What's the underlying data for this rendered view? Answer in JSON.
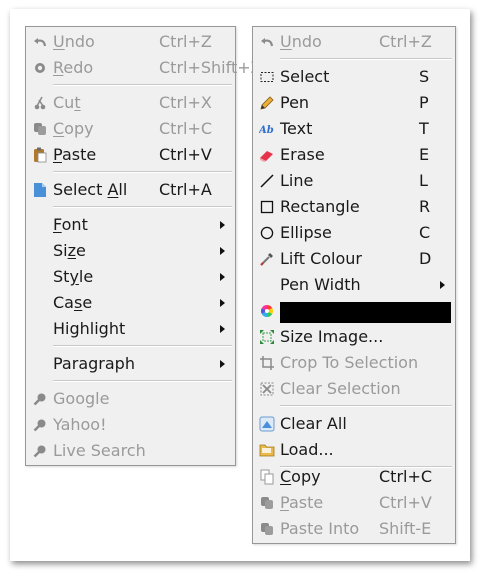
{
  "left_menu": {
    "items": [
      {
        "label": "Undo",
        "u": "U",
        "rest": "ndo",
        "shortcut": "Ctrl+Z",
        "icon": "undo-icon"
      },
      {
        "label": "Redo",
        "u": "R",
        "rest": "edo",
        "shortcut": "Ctrl+Shift+Z",
        "icon": "redo-icon"
      },
      {
        "label": "Cut",
        "pre": "Cu",
        "u": "t",
        "shortcut": "Ctrl+X",
        "icon": "cut-icon"
      },
      {
        "label": "Copy",
        "u": "C",
        "rest": "opy",
        "shortcut": "Ctrl+C",
        "icon": "copy-icon"
      },
      {
        "label": "Paste",
        "u": "P",
        "rest": "aste",
        "shortcut": "Ctrl+V",
        "icon": "paste-icon"
      },
      {
        "label": "Select All",
        "pre": "Select ",
        "u": "A",
        "rest": "ll",
        "shortcut": "Ctrl+A",
        "icon": "select-all-icon"
      },
      {
        "label": "Font",
        "u": "F",
        "rest": "ont"
      },
      {
        "label": "Size",
        "pre": "Si",
        "u": "z",
        "rest": "e"
      },
      {
        "label": "Style",
        "pre": "St",
        "u": "y",
        "rest": "le"
      },
      {
        "label": "Case",
        "pre": "Ca",
        "u": "s",
        "rest": "e"
      },
      {
        "label": "Highlight"
      },
      {
        "label": "Paragraph"
      },
      {
        "label": "Google",
        "icon": "search-icon"
      },
      {
        "label": "Yahoo!",
        "icon": "search-icon"
      },
      {
        "label": "Live Search",
        "icon": "search-icon"
      }
    ]
  },
  "right_menu": {
    "items": [
      {
        "label": "Undo",
        "u": "U",
        "rest": "ndo",
        "shortcut": "Ctrl+Z",
        "icon": "undo-icon"
      },
      {
        "label": "Select",
        "key": "S",
        "icon": "select-rect-icon"
      },
      {
        "label": "Pen",
        "key": "P",
        "icon": "pen-icon"
      },
      {
        "label": "Text",
        "key": "T",
        "icon": "text-icon"
      },
      {
        "label": "Erase",
        "key": "E",
        "icon": "eraser-icon"
      },
      {
        "label": "Line",
        "key": "L",
        "icon": "line-icon"
      },
      {
        "label": "Rectangle",
        "key": "R",
        "icon": "rectangle-icon"
      },
      {
        "label": "Ellipse",
        "key": "C",
        "icon": "ellipse-icon"
      },
      {
        "label": "Lift Colour",
        "key": "D",
        "icon": "eyedropper-icon"
      },
      {
        "label": "Pen Width"
      },
      {
        "label": "",
        "icon": "color-wheel-icon",
        "swatch": "#000000"
      },
      {
        "label": "Size Image...",
        "icon": "resize-icon"
      },
      {
        "label": "Crop To Selection",
        "icon": "crop-icon"
      },
      {
        "label": "Clear Selection",
        "icon": "clear-selection-icon"
      },
      {
        "label": "Clear All",
        "icon": "clear-all-icon"
      },
      {
        "label": "Load...",
        "icon": "folder-icon"
      },
      {
        "label": "Copy",
        "u": "C",
        "rest": "opy",
        "shortcut": "Ctrl+C",
        "icon": "copy-icon"
      },
      {
        "label": "Paste",
        "u": "P",
        "rest": "aste",
        "shortcut": "Ctrl+V",
        "icon": "paste-icon"
      },
      {
        "label": "Paste Into",
        "shortcut": "Shift-E",
        "icon": "paste-into-icon"
      }
    ]
  },
  "colors": {
    "menu_bg": "#f0f0f0",
    "disabled_text": "#9a9a9a",
    "swatch": "#000000"
  }
}
